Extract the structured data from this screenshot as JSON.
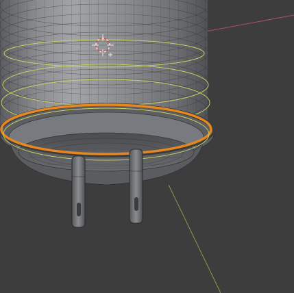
{
  "viewport": {
    "mode": "3d-viewport",
    "background": "#3d3d3d",
    "colors": {
      "mesh_fill_light": "#8d8f93",
      "mesh_fill_mid": "#6f7175",
      "mesh_fill_dark": "#4b4d50",
      "wire": "#2a2a2a",
      "selected_edge_loop": "#e8871e",
      "selection_rings": "#c7cf63",
      "axis_x": "#b2506a",
      "axis_y": "#8a9b49",
      "cursor_red": "#d14a4a",
      "cursor_white": "#e8e8e8"
    },
    "objects": [
      {
        "name": "cylinder-body",
        "icon": "mesh-icon"
      },
      {
        "name": "plug-pins",
        "icon": "mesh-icon"
      }
    ],
    "overlays": {
      "axis_lines": [
        "x-axis-line",
        "y-axis-line"
      ],
      "cursor": "3d-cursor-icon",
      "selection": "edge-loop-selected"
    }
  }
}
